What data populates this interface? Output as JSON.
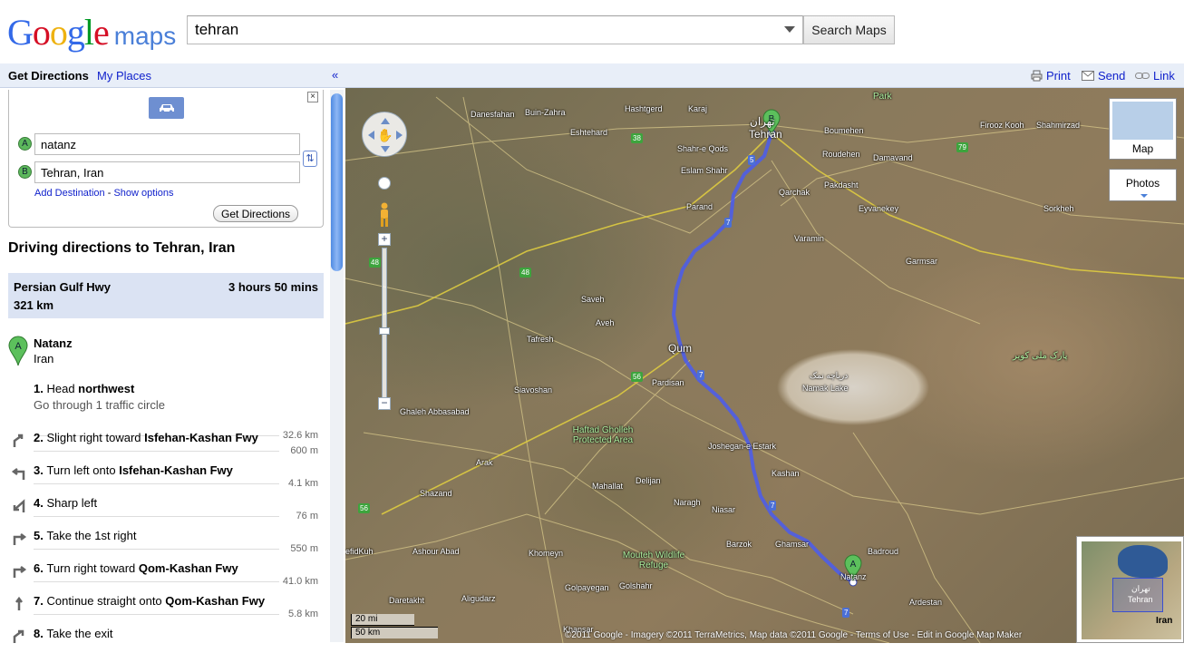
{
  "header": {
    "logo_google": "Google",
    "logo_maps": "maps",
    "search_value": "tehran",
    "search_button": "Search Maps"
  },
  "panel": {
    "tab_directions": "Get Directions",
    "tab_places": "My Places",
    "collapse_label": "«",
    "close_label": "×",
    "marker_a": "A",
    "marker_b": "B",
    "origin": "natanz",
    "destination": "Tehran, Iran",
    "add_destination": "Add Destination",
    "separator": " - ",
    "show_options": "Show options",
    "get_directions_button": "Get Directions",
    "driving_title": "Driving directions to Tehran, Iran",
    "summary": {
      "road": "Persian Gulf Hwy",
      "time": "3 hours 50 mins",
      "distance": "321 km"
    },
    "start": {
      "pin": "A",
      "name": "Natanz",
      "sub": "Iran"
    }
  },
  "steps": [
    {
      "num": "1.",
      "pre": "Head ",
      "bold": "northwest",
      "post": "",
      "note": "Go through 1 traffic circle",
      "dist": "32.6 km",
      "icon": "none"
    },
    {
      "num": "2.",
      "pre": "Slight right toward ",
      "bold": "Isfehan-Kashan Fwy",
      "post": "",
      "note": "",
      "dist": "600 m",
      "icon": "slight-right-icon"
    },
    {
      "num": "3.",
      "pre": "Turn left onto ",
      "bold": "Isfehan-Kashan Fwy",
      "post": "",
      "note": "",
      "dist": "4.1 km",
      "icon": "turn-left-icon"
    },
    {
      "num": "4.",
      "pre": "Sharp left",
      "bold": "",
      "post": "",
      "note": "",
      "dist": "76 m",
      "icon": "sharp-left-icon"
    },
    {
      "num": "5.",
      "pre": "Take the 1st right",
      "bold": "",
      "post": "",
      "note": "",
      "dist": "550 m",
      "icon": "turn-right-icon"
    },
    {
      "num": "6.",
      "pre": "Turn right toward ",
      "bold": "Qom-Kashan Fwy",
      "post": "",
      "note": "",
      "dist": "41.0 km",
      "icon": "turn-right-icon"
    },
    {
      "num": "7.",
      "pre": "Continue straight onto ",
      "bold": "Qom-Kashan Fwy",
      "post": "",
      "note": "",
      "dist": "5.8 km",
      "icon": "straight-icon"
    },
    {
      "num": "8.",
      "pre": "Take the exit",
      "bold": "",
      "post": "",
      "note": "",
      "dist": "",
      "icon": "exit-icon"
    }
  ],
  "map_toolbar": {
    "print": "Print",
    "send": "Send",
    "link": "Link"
  },
  "map": {
    "layer_map": "Map",
    "layer_photos": "Photos",
    "overview_label": "Iran",
    "overview_persian": "تهران",
    "overview_name": "Tehran",
    "scale_mi": "20 mi",
    "scale_km": "50 km",
    "copyright": "©2011 Google - Imagery ©2011 TerraMetrics, Map data ©2011 Google - Terms of Use - Edit in Google Map Maker",
    "route_color": "#4a5cf0",
    "places": [
      {
        "id": "tehran",
        "text": "Tehran",
        "big": true
      },
      {
        "id": "tehran-fa",
        "text": "تهران",
        "big": true
      },
      {
        "id": "karaj",
        "text": "Karaj"
      },
      {
        "id": "hashtgerd",
        "text": "Hashtgerd"
      },
      {
        "id": "eshtehard",
        "text": "Eshtehard"
      },
      {
        "id": "buin",
        "text": "Buin-Zahra"
      },
      {
        "id": "danesfahan",
        "text": "Danesfahan"
      },
      {
        "id": "shahr-e-qods",
        "text": "Shahr-e Qods"
      },
      {
        "id": "eslamshahr",
        "text": "Eslam Shahr"
      },
      {
        "id": "parand",
        "text": "Parand"
      },
      {
        "id": "qarchak",
        "text": "Qarchak"
      },
      {
        "id": "pakdasht",
        "text": "Pakdasht"
      },
      {
        "id": "eyvanekey",
        "text": "Eyvanekey"
      },
      {
        "id": "varamin",
        "text": "Varamin"
      },
      {
        "id": "roudehen",
        "text": "Roudehen"
      },
      {
        "id": "damavand",
        "text": "Damavand"
      },
      {
        "id": "boumehen",
        "text": "Boumehen"
      },
      {
        "id": "firoozkooh",
        "text": "Firooz Kooh"
      },
      {
        "id": "shahmirzad",
        "text": "Shahmirzad"
      },
      {
        "id": "sorkheh",
        "text": "Sorkheh"
      },
      {
        "id": "garmsar",
        "text": "Garmsar"
      },
      {
        "id": "saveh",
        "text": "Saveh"
      },
      {
        "id": "aveh",
        "text": "Aveh"
      },
      {
        "id": "qom",
        "text": "Qum",
        "big": true
      },
      {
        "id": "tafresh",
        "text": "Tafresh"
      },
      {
        "id": "siavoshan",
        "text": "Siavoshan"
      },
      {
        "id": "pardisan",
        "text": "Pardisan"
      },
      {
        "id": "ghaleh",
        "text": "Ghaleh Abbasabad"
      },
      {
        "id": "namak",
        "text": "Namak Lake",
        "green": false
      },
      {
        "id": "namak-fa",
        "text": "دریاچه نمک"
      },
      {
        "id": "haftad",
        "text": "Haftad Gholleh Protected Area",
        "green": true
      },
      {
        "id": "arak",
        "text": "Arak"
      },
      {
        "id": "shazand",
        "text": "Shazand"
      },
      {
        "id": "mahallat",
        "text": "Mahallat"
      },
      {
        "id": "delijan",
        "text": "Delijan"
      },
      {
        "id": "joshegan",
        "text": "Joshegan-e Estark"
      },
      {
        "id": "kashan",
        "text": "Kashan"
      },
      {
        "id": "naragh",
        "text": "Naragh"
      },
      {
        "id": "niasar",
        "text": "Niasar"
      },
      {
        "id": "barzok",
        "text": "Barzok"
      },
      {
        "id": "ghamsar",
        "text": "Ghamsar"
      },
      {
        "id": "badroud",
        "text": "Badroud"
      },
      {
        "id": "natanz",
        "text": "Natanz"
      },
      {
        "id": "ardestan",
        "text": "Ardestan"
      },
      {
        "id": "khomeyn",
        "text": "Khomeyn"
      },
      {
        "id": "ashour",
        "text": "Ashour Abad"
      },
      {
        "id": "mouteh",
        "text": "Mouteh Wildlife Refuge",
        "green": true
      },
      {
        "id": "golpayegan",
        "text": "Golpayegan"
      },
      {
        "id": "golshahr",
        "text": "Golshahr"
      },
      {
        "id": "aligudarz",
        "text": "Aligudarz"
      },
      {
        "id": "daretakht",
        "text": "Daretakht"
      },
      {
        "id": "efidkuh",
        "text": "efidKuh"
      },
      {
        "id": "khansar",
        "text": "Khansar"
      },
      {
        "id": "kavir",
        "text": "پارک ملی کویر",
        "green": true
      },
      {
        "id": "park",
        "text": "Park",
        "green": true
      }
    ],
    "shields": [
      {
        "id": "s38",
        "text": "38",
        "color": "g"
      },
      {
        "id": "s79",
        "text": "79",
        "color": "g"
      },
      {
        "id": "s5",
        "text": "5",
        "color": "b"
      },
      {
        "id": "s7a",
        "text": "7",
        "color": "b"
      },
      {
        "id": "s48a",
        "text": "48",
        "color": "g"
      },
      {
        "id": "s48b",
        "text": "48",
        "color": "g"
      },
      {
        "id": "s56a",
        "text": "56",
        "color": "g"
      },
      {
        "id": "s56b",
        "text": "56",
        "color": "g"
      },
      {
        "id": "s7b",
        "text": "7",
        "color": "b"
      },
      {
        "id": "s7c",
        "text": "7",
        "color": "b"
      },
      {
        "id": "s7d",
        "text": "7",
        "color": "b"
      }
    ]
  }
}
